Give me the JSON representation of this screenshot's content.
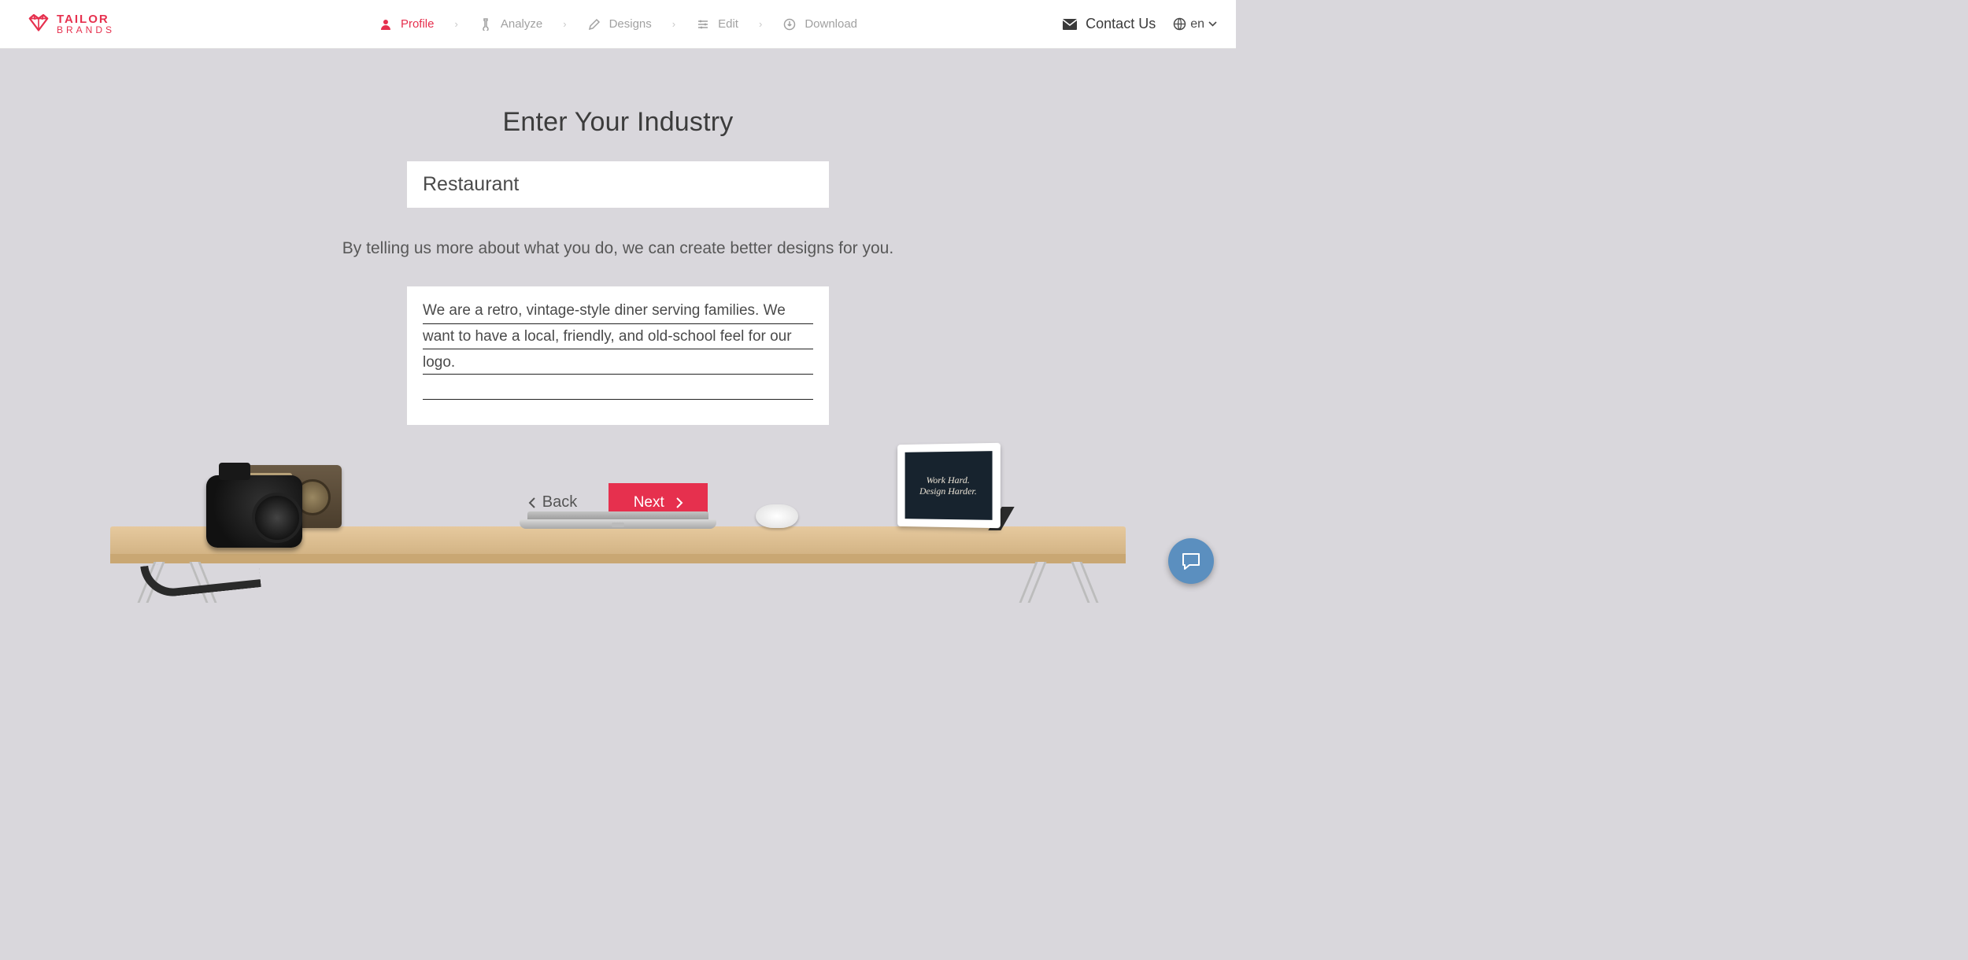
{
  "brand": {
    "line1": "TAILOR",
    "line2": "BRANDS"
  },
  "steps": [
    {
      "label": "Profile",
      "active": true
    },
    {
      "label": "Analyze",
      "active": false
    },
    {
      "label": "Designs",
      "active": false
    },
    {
      "label": "Edit",
      "active": false
    },
    {
      "label": "Download",
      "active": false
    }
  ],
  "header": {
    "contact_label": "Contact Us",
    "language": "en"
  },
  "page": {
    "title": "Enter Your Industry",
    "industry_value": "Restaurant",
    "subtitle": "By telling us more about what you do, we can create better designs for you.",
    "description_value": "We are a retro, vintage-style diner serving families. We want to have a local, friendly, and old-school feel for our logo."
  },
  "nav": {
    "back_label": "Back",
    "next_label": "Next"
  },
  "frame": {
    "line1": "Work Hard.",
    "line2": "Design Harder."
  }
}
